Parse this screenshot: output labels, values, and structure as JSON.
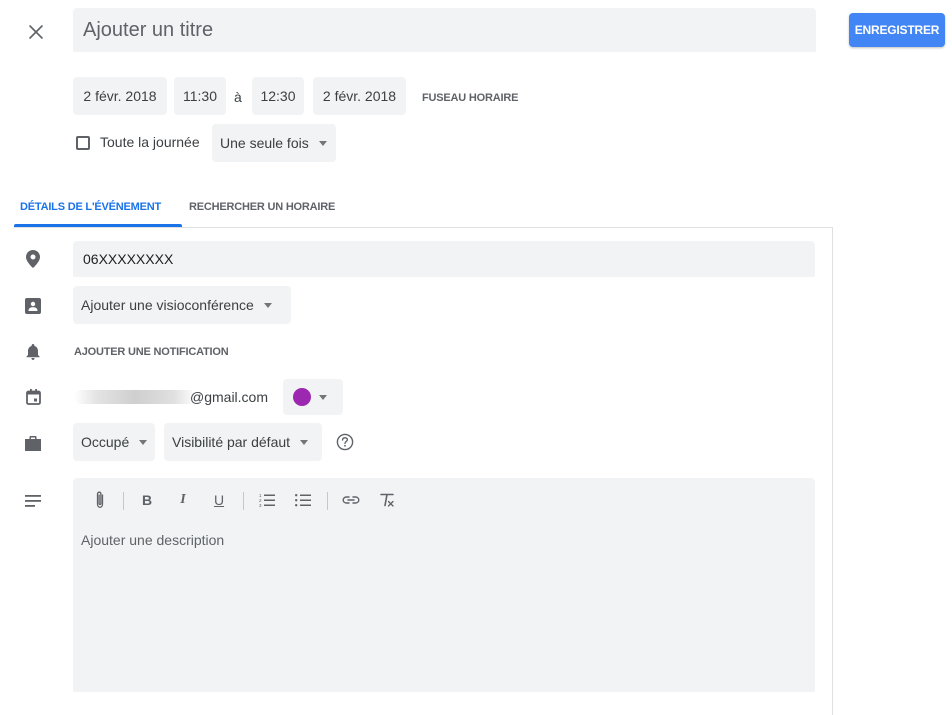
{
  "title": {
    "placeholder": "Ajouter un titre"
  },
  "save_label": "ENREGISTRER",
  "dates": {
    "start_date": "2 févr. 2018",
    "start_time": "11:30",
    "separator": "à",
    "end_time": "12:30",
    "end_date": "2 févr. 2018",
    "timezone_label": "FUSEAU HORAIRE"
  },
  "allday": {
    "label": "Toute la journée",
    "checked": false
  },
  "repeat": {
    "value": "Une seule fois"
  },
  "tabs": [
    {
      "label": "DÉTAILS DE L'ÉVÉNEMENT",
      "active": true
    },
    {
      "label": "RECHERCHER UN HORAIRE",
      "active": false
    }
  ],
  "location": {
    "value": "06XXXXXXXX"
  },
  "conference": {
    "label": "Ajouter une visioconférence"
  },
  "notification": {
    "label": "AJOUTER UNE NOTIFICATION"
  },
  "calendar": {
    "email_suffix": "@gmail.com",
    "color": "#9c27b0"
  },
  "availability": {
    "value": "Occupé"
  },
  "visibility": {
    "value": "Visibilité par défaut"
  },
  "toolbar": {
    "bold_label": "B",
    "italic_label": "I",
    "underline_label": "U",
    "tools": [
      "attachment-icon",
      "bold",
      "italic",
      "underline",
      "numbered-list-icon",
      "bulleted-list-icon",
      "link-icon",
      "clear-formatting-icon"
    ]
  },
  "description": {
    "placeholder": "Ajouter une description"
  },
  "colors": {
    "accent": "#4285f4",
    "tab_active": "#1a73e8",
    "field_bg": "#f1f3f4"
  },
  "icons": {
    "close": "close-icon",
    "location": "location-pin-icon",
    "conference": "video-conference-icon",
    "notification": "bell-icon",
    "calendar": "calendar-icon",
    "availability": "briefcase-icon",
    "description": "notes-icon",
    "help": "help-circle-icon"
  }
}
